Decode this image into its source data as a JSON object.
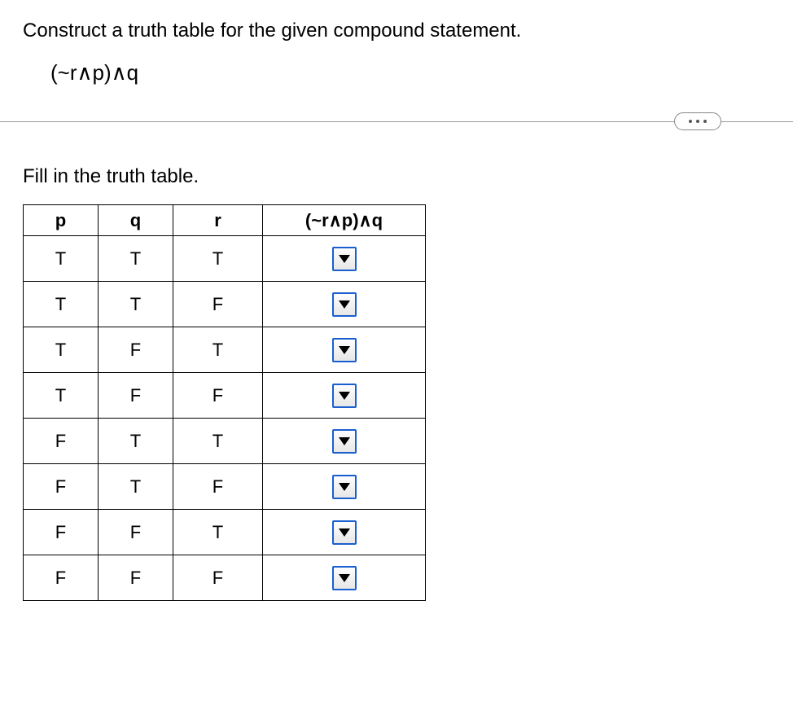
{
  "instruction": "Construct a truth table for the given compound statement.",
  "formula": "(~r∧p)∧q",
  "fill_text": "Fill in the truth table.",
  "headers": {
    "p": "p",
    "q": "q",
    "r": "r",
    "result": "(~r∧p)∧q"
  },
  "rows": [
    {
      "p": "T",
      "q": "T",
      "r": "T"
    },
    {
      "p": "T",
      "q": "T",
      "r": "F"
    },
    {
      "p": "T",
      "q": "F",
      "r": "T"
    },
    {
      "p": "T",
      "q": "F",
      "r": "F"
    },
    {
      "p": "F",
      "q": "T",
      "r": "T"
    },
    {
      "p": "F",
      "q": "T",
      "r": "F"
    },
    {
      "p": "F",
      "q": "F",
      "r": "T"
    },
    {
      "p": "F",
      "q": "F",
      "r": "F"
    }
  ]
}
